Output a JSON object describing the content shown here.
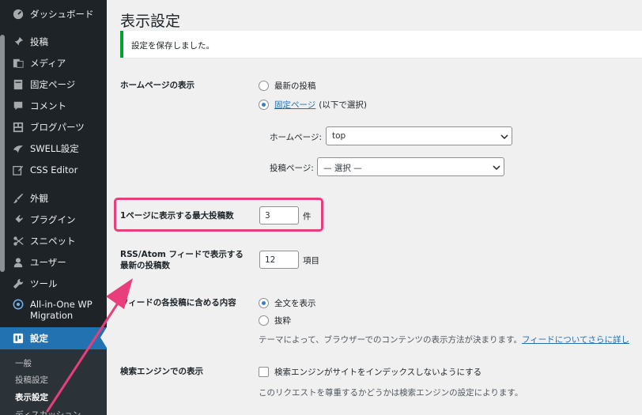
{
  "sidebar": {
    "items": [
      {
        "label": "ダッシュボード",
        "icon": "dashboard-icon"
      },
      {
        "label": "投稿",
        "icon": "pin-icon"
      },
      {
        "label": "メディア",
        "icon": "media-icon"
      },
      {
        "label": "固定ページ",
        "icon": "page-icon"
      },
      {
        "label": "コメント",
        "icon": "comment-icon"
      },
      {
        "label": "ブログパーツ",
        "icon": "blocks-icon"
      },
      {
        "label": "SWELL設定",
        "icon": "swell-icon"
      },
      {
        "label": "CSS Editor",
        "icon": "edit-icon"
      },
      {
        "label": "外観",
        "icon": "brush-icon"
      },
      {
        "label": "プラグイン",
        "icon": "plugin-icon"
      },
      {
        "label": "スニペット",
        "icon": "scissors-icon"
      },
      {
        "label": "ユーザー",
        "icon": "user-icon"
      },
      {
        "label": "ツール",
        "icon": "wrench-icon"
      },
      {
        "label": "All-in-One WP Migration",
        "icon": "migration-icon"
      },
      {
        "label": "設定",
        "icon": "settings-icon"
      }
    ],
    "submenu": [
      {
        "label": "一般"
      },
      {
        "label": "投稿設定"
      },
      {
        "label": "表示設定"
      },
      {
        "label": "ディスカッション"
      }
    ]
  },
  "page": {
    "title": "表示設定",
    "notice": "設定を保存しました。"
  },
  "homepage": {
    "label": "ホームページの表示",
    "option_latest": "最新の投稿",
    "option_static_link": "固定ページ",
    "option_static_suffix": "(以下で選択)",
    "front_label": "ホームページ:",
    "front_value": "top",
    "posts_label": "投稿ページ:",
    "posts_value": "— 選択 —"
  },
  "posts_per_page": {
    "label": "1ページに表示する最大投稿数",
    "value": "3",
    "unit": "件"
  },
  "feed_count": {
    "label_line1": "RSS/Atom フィードで表示する",
    "label_line2": "最新の投稿数",
    "value": "12",
    "unit": "項目"
  },
  "feed_content": {
    "label": "フィードの各投稿に含める内容",
    "option_full": "全文を表示",
    "option_excerpt": "抜粋",
    "description": "テーマによって、ブラウザーでのコンテンツの表示方法が決まります。",
    "description_link": "フィードについてさらに詳し"
  },
  "search_engine": {
    "label": "検索エンジンでの表示",
    "checkbox_label": "検索エンジンがサイトをインデックスしないようにする",
    "description": "このリクエストを尊重するかどうかは検索エンジンの設定によります。"
  },
  "colors": {
    "sidebar_bg": "#1d2327",
    "accent": "#2271b1",
    "highlight": "#e83e7b",
    "notice_border": "#00a32a"
  }
}
